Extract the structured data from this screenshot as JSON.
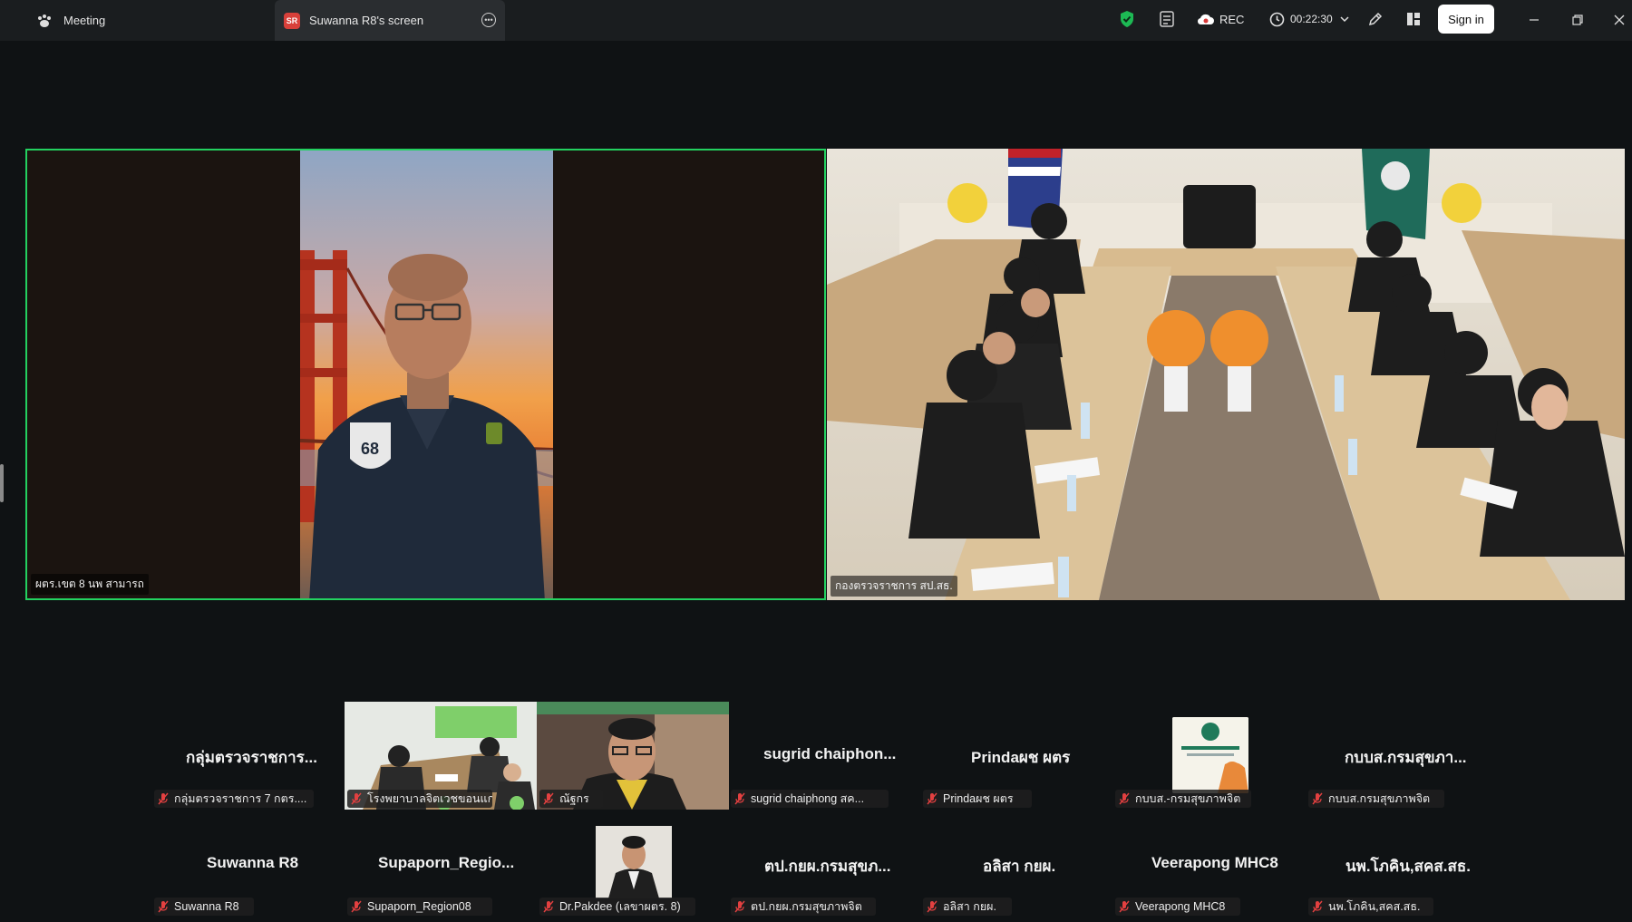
{
  "topbar": {
    "meeting_tab": "Meeting",
    "share_tab_badge": "SR",
    "share_tab": "Suwanna R8's screen",
    "rec": "REC",
    "timer": "00:22:30",
    "signin": "Sign in",
    "colors": {
      "shield": "#1db954",
      "rec_icon": "#ffffff",
      "accent_green": "#23d160"
    }
  },
  "main": {
    "left_tile_name": "ผตร.เขต 8 นพ สามารถ",
    "right_tile_name": "กองตรวจราชการ สป.สธ."
  },
  "gallery": {
    "row1": [
      {
        "name": "กลุ่มตรวจราชการ...",
        "label": "กลุ่มตรวจราชการ 7 กตร...."
      },
      {
        "name": "",
        "label": "โรงพยาบาลจิตเวชขอนแก..."
      },
      {
        "name": "",
        "label": "ณัฐกร"
      },
      {
        "name": "sugrid  chaiphon...",
        "label": "sugrid chaiphong  สค..."
      },
      {
        "name": "Prindaผช ผตร",
        "label": "Prindaผช ผตร"
      },
      {
        "name": "",
        "label": "กบบส.-กรมสุขภาพจิต"
      },
      {
        "name": "กบบส.กรมสุขภา...",
        "label": "กบบส.กรมสุขภาพจิต"
      }
    ],
    "row2": [
      {
        "name": "Suwanna R8",
        "label": "Suwanna R8"
      },
      {
        "name": "Supaporn_Regio...",
        "label": "Supaporn_Region08"
      },
      {
        "name": "",
        "label": "Dr.Pakdee (เลขาผตร. 8)"
      },
      {
        "name": "ตป.กยผ.กรมสุขภ...",
        "label": "ตป.กยผ.กรมสุขภาพจิต"
      },
      {
        "name": "อลิสา กยผ.",
        "label": "อลิสา กยผ."
      },
      {
        "name": "Veerapong MHC8",
        "label": "Veerapong MHC8"
      },
      {
        "name": "นพ.โภคิน,สคส.สธ.",
        "label": "นพ.โภคิน,สคส.สธ."
      }
    ]
  }
}
